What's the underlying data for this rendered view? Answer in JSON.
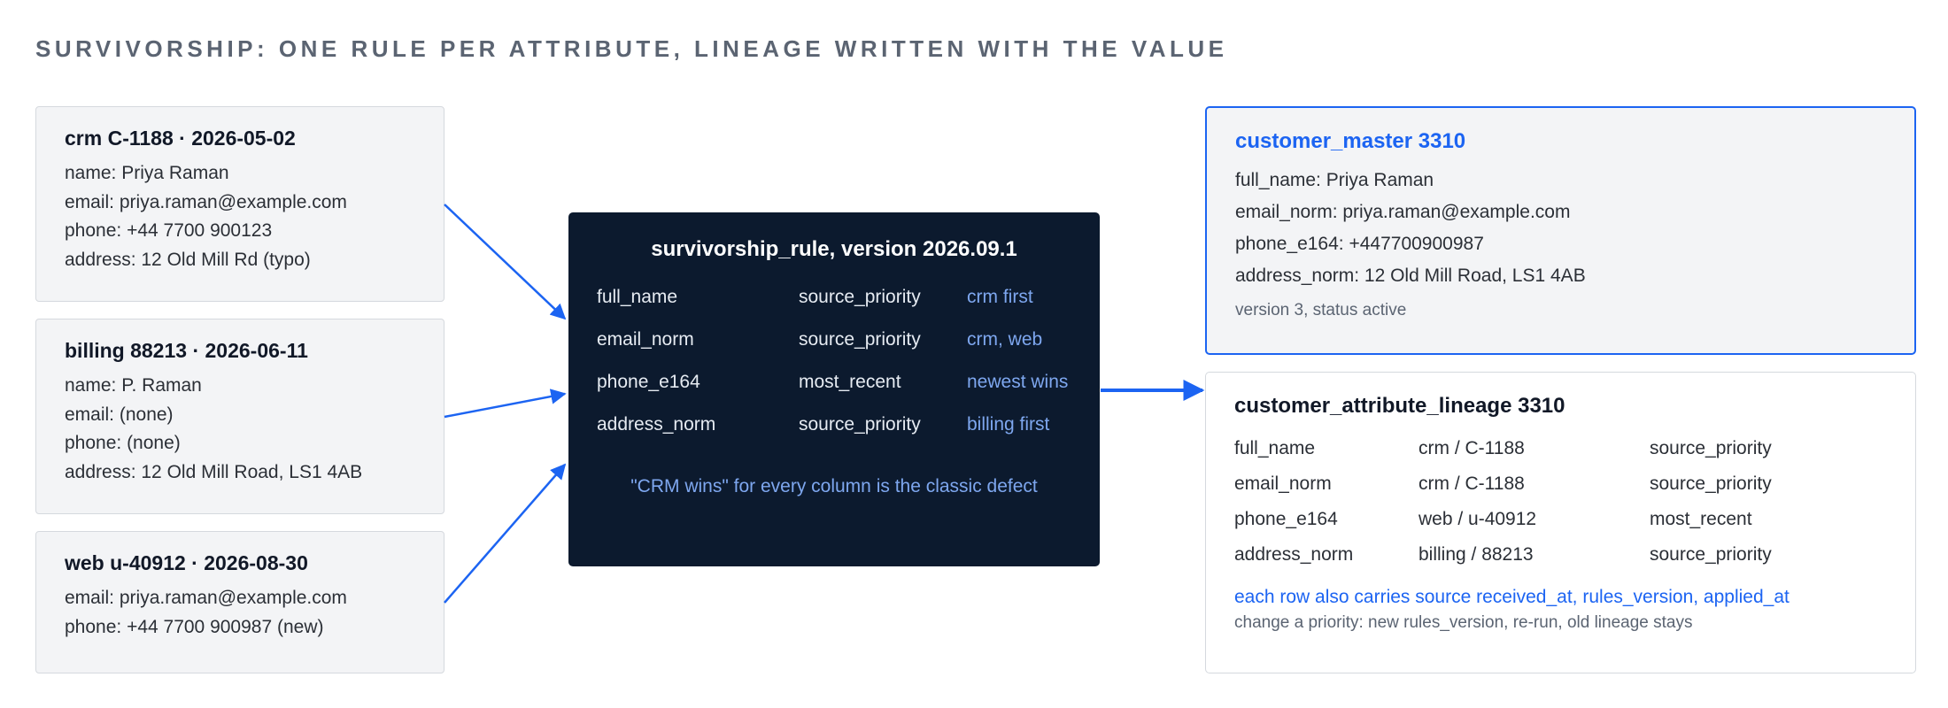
{
  "title": "SURVIVORSHIP: ONE RULE PER ATTRIBUTE, LINEAGE WRITTEN WITH THE VALUE",
  "sources": [
    {
      "header": "crm C-1188 · 2026-05-02",
      "lines": [
        "name: Priya Raman",
        "email: priya.raman@example.com",
        "phone: +44 7700 900123",
        "address: 12 Old Mill Rd (typo)"
      ]
    },
    {
      "header": "billing 88213 · 2026-06-11",
      "lines": [
        "name: P. Raman",
        "email: (none)",
        "phone: (none)",
        "address: 12 Old Mill Road, LS1 4AB"
      ]
    },
    {
      "header": "web u-40912 · 2026-08-30",
      "lines": [
        "email: priya.raman@example.com",
        "phone: +44 7700 900987 (new)"
      ]
    }
  ],
  "rule": {
    "header": "survivorship_rule, version 2026.09.1",
    "rows": [
      {
        "attribute": "full_name",
        "method": "source_priority",
        "detail": "crm first"
      },
      {
        "attribute": "email_norm",
        "method": "source_priority",
        "detail": "crm, web"
      },
      {
        "attribute": "phone_e164",
        "method": "most_recent",
        "detail": "newest wins"
      },
      {
        "attribute": "address_norm",
        "method": "source_priority",
        "detail": "billing first"
      }
    ],
    "note": "\"CRM wins\" for every column is the classic defect"
  },
  "master": {
    "header": "customer_master 3310",
    "lines": [
      "full_name: Priya Raman",
      "email_norm: priya.raman@example.com",
      "phone_e164: +447700900987",
      "address_norm: 12 Old Mill Road, LS1 4AB"
    ],
    "meta": "version 3, status active"
  },
  "lineage": {
    "header": "customer_attribute_lineage 3310",
    "rows": [
      {
        "attribute": "full_name",
        "source": "crm / C-1188",
        "rule": "source_priority"
      },
      {
        "attribute": "email_norm",
        "source": "crm / C-1188",
        "rule": "source_priority"
      },
      {
        "attribute": "phone_e164",
        "source": "web / u-40912",
        "rule": "most_recent"
      },
      {
        "attribute": "address_norm",
        "source": "billing / 88213",
        "rule": "source_priority"
      }
    ],
    "note_blue": "each row also carries source received_at, rules_version, applied_at",
    "note_grey": "change a priority: new rules_version, re-run, old lineage stays"
  },
  "colors": {
    "accent": "#1c64f2",
    "rule_bg": "#0c1a2e",
    "card_bg": "#f3f4f6",
    "rule_highlight": "#7ea7ef"
  }
}
